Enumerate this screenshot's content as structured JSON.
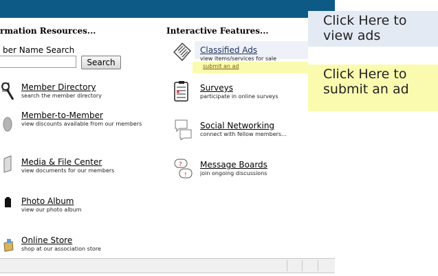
{
  "header": {
    "left_column_title": "rmation Resources...",
    "right_column_title": "Interactive Features..."
  },
  "search": {
    "label": "ber Name Search",
    "input_value": "",
    "button_label": "Search"
  },
  "left_items": [
    {
      "title": "Member Directory",
      "desc": "search the member directory",
      "icon": "directory-icon"
    },
    {
      "title": "Member-to-Member",
      "desc": "view discounts available from our members",
      "icon": "member-discount-icon"
    },
    {
      "title": "Media & File Center",
      "desc": "view documents for our members",
      "icon": "file-icon"
    },
    {
      "title": "Photo Album",
      "desc": "view our photo album",
      "icon": "photo-icon"
    },
    {
      "title": "Online Store",
      "desc": "shop at our association store",
      "icon": "store-icon"
    }
  ],
  "right_items": [
    {
      "title": "Classified Ads",
      "desc": "view items/services for sale",
      "sub_link": "submit an ad",
      "icon": "newspaper-icon"
    },
    {
      "title": "Surveys",
      "desc": "participate in online surveys",
      "icon": "survey-clipboard-icon"
    },
    {
      "title": "Social Networking",
      "desc": "connect with fellow members...",
      "icon": "speech-bubbles-icon"
    },
    {
      "title": "Message Boards",
      "desc": "join ongoing discussions",
      "icon": "message-bubbles-icon"
    }
  ],
  "callouts": {
    "view_ads": "Click Here to view ads",
    "submit_ad": "Click Here to submit an ad"
  },
  "colors": {
    "topbar": "#0d5a86",
    "callout_view": "#e4eaf3",
    "callout_submit": "#fbfbb0"
  }
}
